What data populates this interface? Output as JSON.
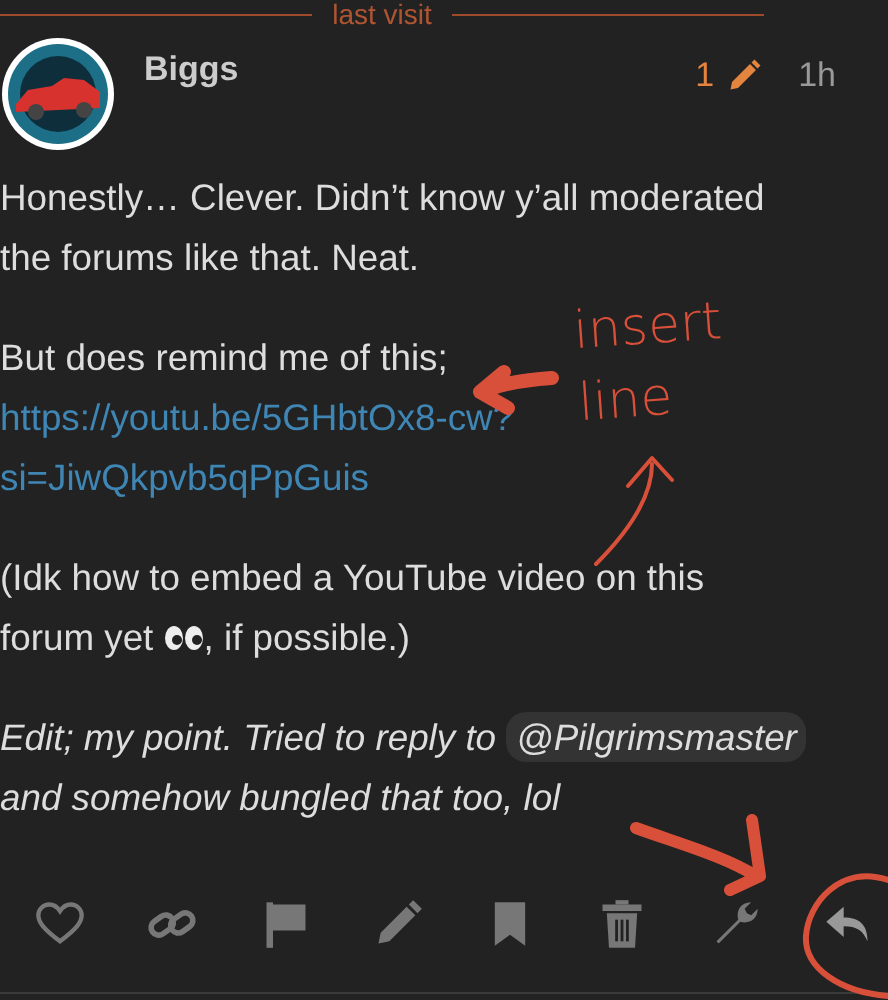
{
  "divider": {
    "label": "last visit"
  },
  "post": {
    "author": "Biggs",
    "edit_count": "1",
    "age": "1h",
    "paragraphs": [
      {
        "italic": false,
        "runs": [
          {
            "kind": "text",
            "text": "Honestly… Clever. Didn’t know y’all moderated the forums like that. Neat."
          }
        ]
      },
      {
        "italic": false,
        "runs": [
          {
            "kind": "text",
            "text": "But does remind me of this;"
          },
          {
            "kind": "link",
            "text": "https://youtu.be/5GHbtOx8-cw?si=JiwQkpvb5qPpGuis"
          }
        ]
      },
      {
        "italic": false,
        "runs": [
          {
            "kind": "text",
            "text": "(Idk how to embed a YouTube video on this"
          },
          {
            "kind": "text",
            "text": "forum yet"
          },
          {
            "kind": "emoji"
          },
          {
            "kind": "text",
            "text": ", if possible.)"
          }
        ]
      },
      {
        "italic": true,
        "runs": [
          {
            "kind": "text",
            "text": "Edit; my point. Tried to reply to"
          },
          {
            "kind": "mention",
            "text": "@Pilgrimsmaster"
          },
          {
            "kind": "text",
            "text": "and somehow bungled that too, lol"
          }
        ]
      }
    ]
  },
  "annotation": {
    "note": "insert line"
  }
}
